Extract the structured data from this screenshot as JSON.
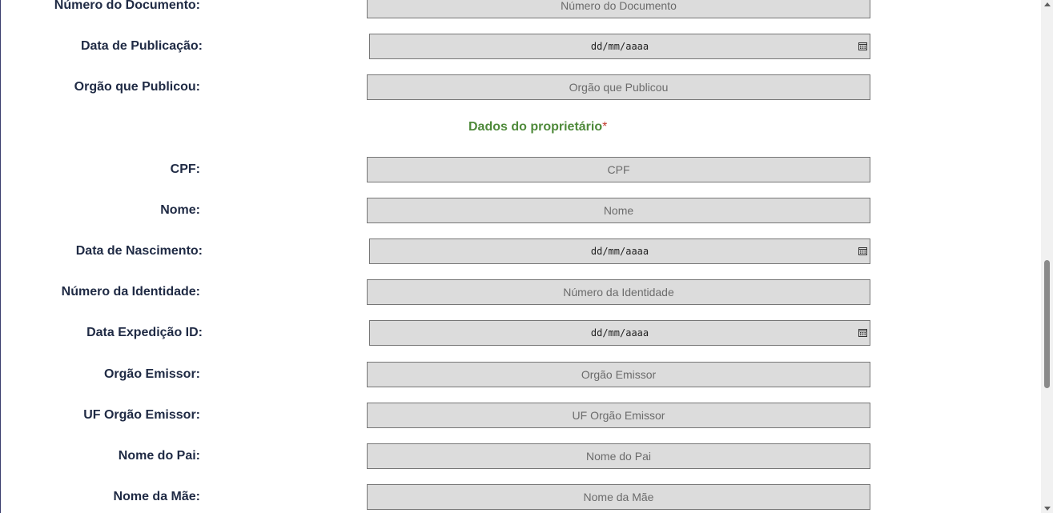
{
  "form": {
    "top_fields": [
      {
        "label": "Número do Documento:",
        "placeholder": "Número do Documento",
        "type": "text"
      },
      {
        "label": "Data de Publicação:",
        "placeholder": "dd/mm/aaaa",
        "type": "date"
      },
      {
        "label": "Orgão que Publicou:",
        "placeholder": "Orgão que Publicou",
        "type": "text"
      }
    ],
    "section_title": "Dados do proprietário",
    "section_required_mark": "*",
    "owner_fields": [
      {
        "label": "CPF:",
        "placeholder": "CPF",
        "type": "text"
      },
      {
        "label": "Nome:",
        "placeholder": "Nome",
        "type": "text"
      },
      {
        "label": "Data de Nascimento:",
        "placeholder": "dd/mm/aaaa",
        "type": "date"
      },
      {
        "label": "Número da Identidade:",
        "placeholder": "Número da Identidade",
        "type": "text"
      },
      {
        "label": "Data Expedição ID:",
        "placeholder": "dd/mm/aaaa",
        "type": "date"
      },
      {
        "label": "Orgão Emissor:",
        "placeholder": "Orgão Emissor",
        "type": "text"
      },
      {
        "label": "UF Orgão Emissor:",
        "placeholder": "UF Orgão Emissor",
        "type": "text"
      },
      {
        "label": "Nome do Pai:",
        "placeholder": "Nome do Pai",
        "type": "text"
      },
      {
        "label": "Nome da Mãe:",
        "placeholder": "Nome da Mãe",
        "type": "text"
      }
    ]
  },
  "icons": {
    "date_picker": "calendar-icon"
  },
  "colors": {
    "section_title": "#4f8a3b",
    "label": "#1f2a44",
    "field_bg": "#dcdcdc"
  }
}
